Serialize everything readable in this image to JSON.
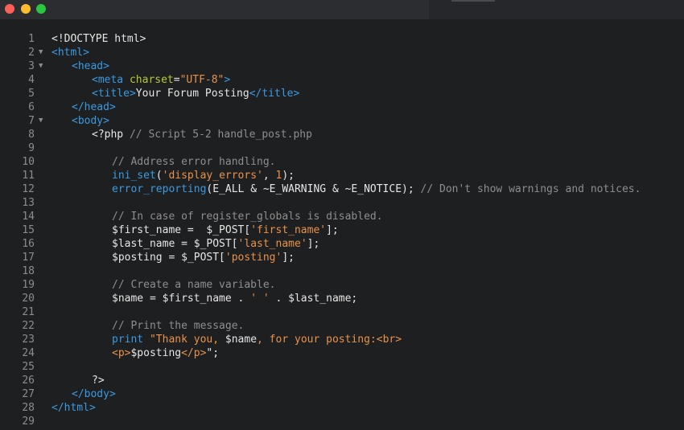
{
  "window": {
    "controls": [
      "close",
      "minimize",
      "maximize"
    ]
  },
  "colors": {
    "background": "#1e1f21",
    "titlebar": "#2c2d30",
    "plain": "#e6e6e6",
    "tag": "#3b9ae1",
    "attr": "#b5c934",
    "string": "#e8924a",
    "comment": "#8e8e8e",
    "line_number": "#8c8c8c"
  },
  "editor": {
    "lines": [
      {
        "n": "1",
        "fold": "",
        "indent": 0,
        "tokens": [
          [
            "t-plain",
            "<!DOCTYPE html>"
          ]
        ]
      },
      {
        "n": "2",
        "fold": "▼",
        "indent": 0,
        "tokens": [
          [
            "t-tag",
            "<html>"
          ]
        ]
      },
      {
        "n": "3",
        "fold": "▼",
        "indent": 1,
        "tokens": [
          [
            "t-tag",
            "<head>"
          ]
        ]
      },
      {
        "n": "4",
        "fold": "",
        "indent": 2,
        "tokens": [
          [
            "t-tag",
            "<meta "
          ],
          [
            "t-attr",
            "charset"
          ],
          [
            "t-plain",
            "="
          ],
          [
            "t-string",
            "\"UTF-8\""
          ],
          [
            "t-tag",
            ">"
          ]
        ]
      },
      {
        "n": "5",
        "fold": "",
        "indent": 2,
        "tokens": [
          [
            "t-tag",
            "<title>"
          ],
          [
            "t-plain",
            "Your Forum Posting"
          ],
          [
            "t-tag",
            "</title>"
          ]
        ]
      },
      {
        "n": "6",
        "fold": "",
        "indent": 1,
        "tokens": [
          [
            "t-tag",
            "</head>"
          ]
        ]
      },
      {
        "n": "7",
        "fold": "▼",
        "indent": 1,
        "tokens": [
          [
            "t-tag",
            "<body>"
          ]
        ]
      },
      {
        "n": "8",
        "fold": "",
        "indent": 2,
        "tokens": [
          [
            "t-plain",
            "<?php "
          ],
          [
            "t-comment",
            "// Script 5-2 handle_post.php"
          ]
        ]
      },
      {
        "n": "9",
        "fold": "",
        "indent": 0,
        "tokens": []
      },
      {
        "n": "10",
        "fold": "",
        "indent": 3,
        "tokens": [
          [
            "t-comment",
            "// Address error handling."
          ]
        ]
      },
      {
        "n": "11",
        "fold": "",
        "indent": 3,
        "tokens": [
          [
            "t-func",
            "ini_set"
          ],
          [
            "t-plain",
            "("
          ],
          [
            "t-string",
            "'display_errors'"
          ],
          [
            "t-plain",
            ", "
          ],
          [
            "t-number",
            "1"
          ],
          [
            "t-plain",
            ");"
          ]
        ]
      },
      {
        "n": "12",
        "fold": "",
        "indent": 3,
        "tokens": [
          [
            "t-func",
            "error_reporting"
          ],
          [
            "t-plain",
            "(E_ALL & ~E_WARNING & ~E_NOTICE); "
          ],
          [
            "t-comment",
            "// Don't show warnings and notices."
          ]
        ]
      },
      {
        "n": "13",
        "fold": "",
        "indent": 0,
        "tokens": []
      },
      {
        "n": "14",
        "fold": "",
        "indent": 3,
        "tokens": [
          [
            "t-comment",
            "// In case of register_globals is disabled."
          ]
        ]
      },
      {
        "n": "15",
        "fold": "",
        "indent": 3,
        "tokens": [
          [
            "t-plain",
            "$first_name =  $_POST["
          ],
          [
            "t-string",
            "'first_name'"
          ],
          [
            "t-plain",
            "];"
          ]
        ]
      },
      {
        "n": "16",
        "fold": "",
        "indent": 3,
        "tokens": [
          [
            "t-plain",
            "$last_name = $_POST["
          ],
          [
            "t-string",
            "'last_name'"
          ],
          [
            "t-plain",
            "];"
          ]
        ]
      },
      {
        "n": "17",
        "fold": "",
        "indent": 3,
        "tokens": [
          [
            "t-plain",
            "$posting = $_POST["
          ],
          [
            "t-string",
            "'posting'"
          ],
          [
            "t-plain",
            "];"
          ]
        ]
      },
      {
        "n": "18",
        "fold": "",
        "indent": 0,
        "tokens": []
      },
      {
        "n": "19",
        "fold": "",
        "indent": 3,
        "tokens": [
          [
            "t-comment",
            "// Create a name variable."
          ]
        ]
      },
      {
        "n": "20",
        "fold": "",
        "indent": 3,
        "tokens": [
          [
            "t-plain",
            "$name = $first_name . "
          ],
          [
            "t-string",
            "' '"
          ],
          [
            "t-plain",
            " . $last_name;"
          ]
        ]
      },
      {
        "n": "21",
        "fold": "",
        "indent": 0,
        "tokens": []
      },
      {
        "n": "22",
        "fold": "",
        "indent": 3,
        "tokens": [
          [
            "t-comment",
            "// Print the message."
          ]
        ]
      },
      {
        "n": "23",
        "fold": "",
        "indent": 3,
        "tokens": [
          [
            "t-func",
            "print "
          ],
          [
            "t-string",
            "\"Thank you, "
          ],
          [
            "t-plain",
            "$name"
          ],
          [
            "t-string",
            ", for your posting:<br>"
          ]
        ]
      },
      {
        "n": "24",
        "fold": "",
        "indent": 3,
        "tokens": [
          [
            "t-string",
            "<p>"
          ],
          [
            "t-plain",
            "$posting"
          ],
          [
            "t-string",
            "</p>"
          ],
          [
            "t-plain",
            "\";"
          ]
        ]
      },
      {
        "n": "25",
        "fold": "",
        "indent": 0,
        "tokens": []
      },
      {
        "n": "26",
        "fold": "",
        "indent": 2,
        "tokens": [
          [
            "t-plain",
            "?>"
          ]
        ]
      },
      {
        "n": "27",
        "fold": "",
        "indent": 1,
        "tokens": [
          [
            "t-tag",
            "</body>"
          ]
        ]
      },
      {
        "n": "28",
        "fold": "",
        "indent": 0,
        "tokens": [
          [
            "t-tag",
            "</html>"
          ]
        ]
      },
      {
        "n": "29",
        "fold": "",
        "indent": 0,
        "tokens": []
      }
    ]
  }
}
